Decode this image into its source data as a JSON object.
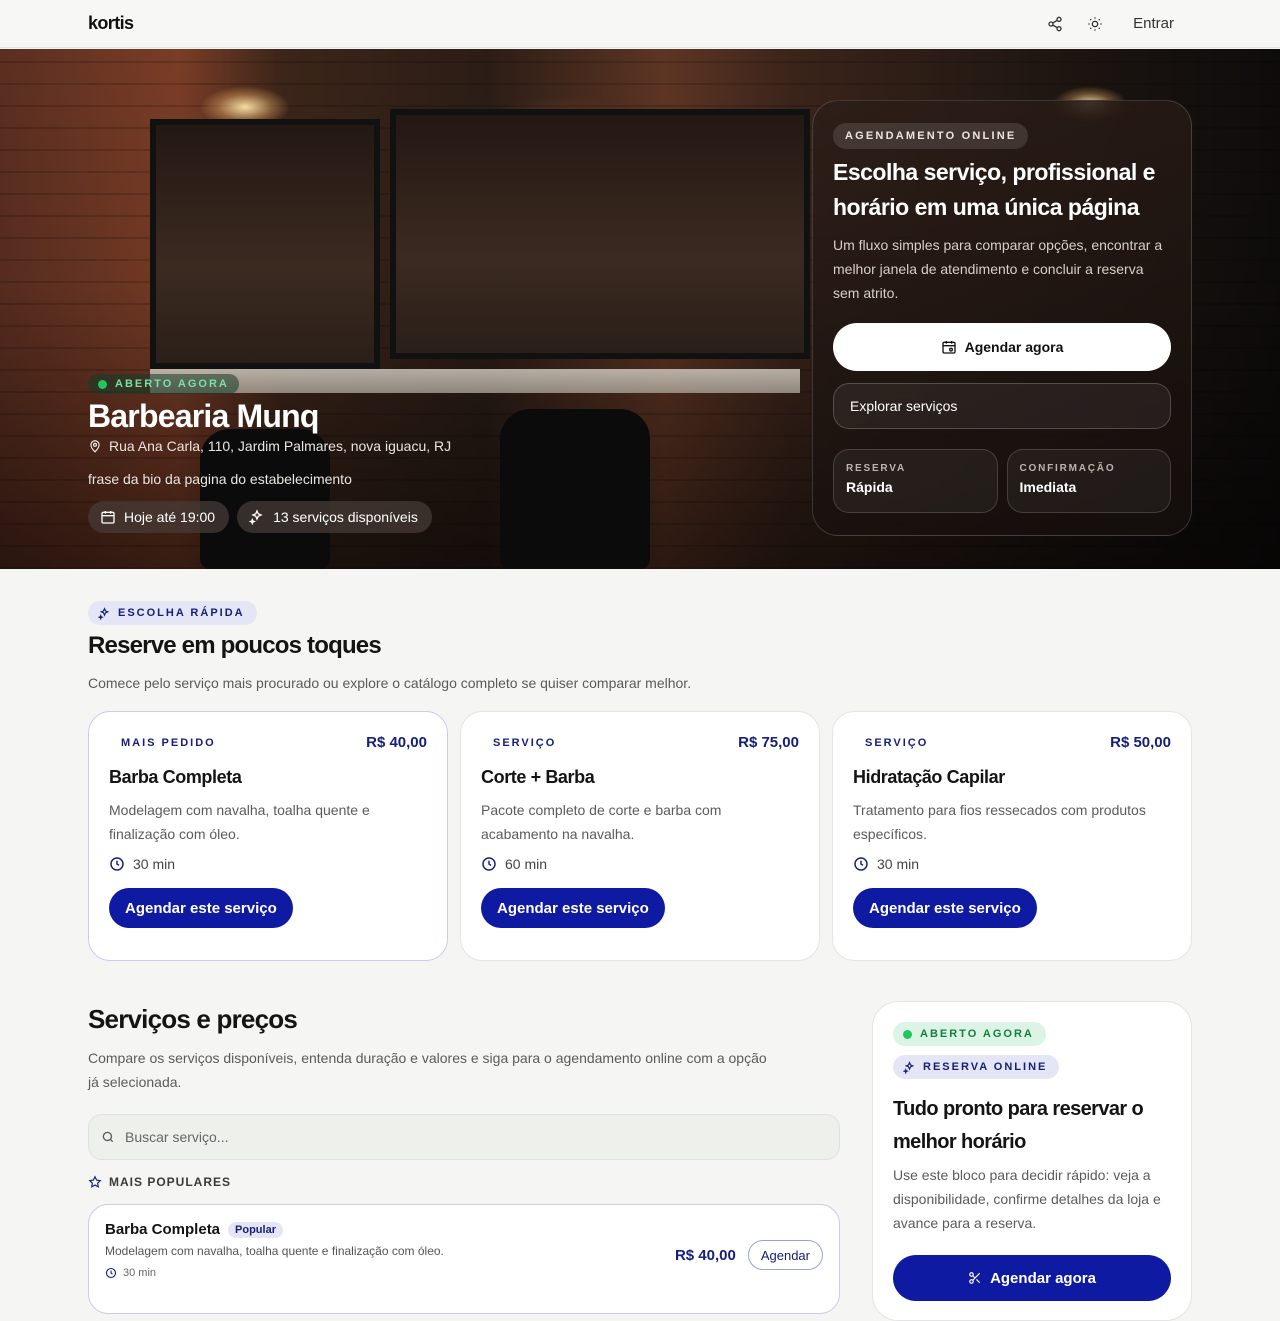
{
  "nav": {
    "logo": "kortis",
    "login": "Entrar"
  },
  "hero": {
    "status": "ABERTO AGORA",
    "name": "Barbearia Munq",
    "address": "Rua Ana Carla, 110, Jardim Palmares, nova iguacu, RJ",
    "bio": "frase da bio da pagina do estabelecimento",
    "hours": "Hoje até 19:00",
    "services_count": "13 serviços disponíveis"
  },
  "booking": {
    "kicker": "AGENDAMENTO ONLINE",
    "title": "Escolha serviço, profissional e horário em uma única página",
    "desc": "Um fluxo simples para comparar opções, encontrar a melhor janela de atendimento e concluir a reserva sem atrito.",
    "cta": "Agendar agora",
    "explore": "Explorar serviços",
    "stats": [
      {
        "label": "RESERVA",
        "value": "Rápida"
      },
      {
        "label": "CONFIRMAÇÃO",
        "value": "Imediata"
      }
    ]
  },
  "quick": {
    "kicker": "ESCOLHA RÁPIDA",
    "title": "Reserve em poucos toques",
    "subtitle": "Comece pelo serviço mais procurado ou explore o catálogo completo se quiser comparar melhor.",
    "cards": [
      {
        "kicker": "MAIS PEDIDO",
        "price": "R$ 40,00",
        "title": "Barba Completa",
        "desc": "Modelagem com navalha, toalha quente e finalização com óleo.",
        "duration": "30 min",
        "cta": "Agendar este serviço"
      },
      {
        "kicker": "SERVIÇO",
        "price": "R$ 75,00",
        "title": "Corte + Barba",
        "desc": "Pacote completo de corte e barba com acabamento na navalha.",
        "duration": "60 min",
        "cta": "Agendar este serviço"
      },
      {
        "kicker": "SERVIÇO",
        "price": "R$ 50,00",
        "title": "Hidratação Capilar",
        "desc": "Tratamento para fios ressecados com produtos específicos.",
        "duration": "30 min",
        "cta": "Agendar este serviço"
      }
    ]
  },
  "services": {
    "title": "Serviços e preços",
    "subtitle": "Compare os serviços disponíveis, entenda duração e valores e siga para o agendamento online com a opção já selecionada.",
    "search_placeholder": "Buscar serviço...",
    "popular_label": "MAIS POPULARES",
    "items": [
      {
        "name": "Barba Completa",
        "badge": "Popular",
        "desc": "Modelagem com navalha, toalha quente e finalização com óleo.",
        "duration": "30 min",
        "price": "R$ 40,00",
        "cta": "Agendar"
      }
    ]
  },
  "side": {
    "status": "ABERTO AGORA",
    "kicker": "RESERVA ONLINE",
    "title": "Tudo pronto para reservar o melhor horário",
    "desc": "Use este bloco para decidir rápido: veja a disponibilidade, confirme detalhes da loja e avance para a reserva.",
    "cta": "Agendar agora"
  },
  "colors": {
    "primary": "#0f1aa3",
    "open": "#22c55e",
    "accent_bg": "#e4e6f6"
  },
  "icons": [
    "share-icon",
    "sun-icon",
    "map-pin-icon",
    "calendar-icon",
    "sparkles-icon",
    "clock-icon",
    "search-icon",
    "star-icon",
    "scissors-icon"
  ]
}
